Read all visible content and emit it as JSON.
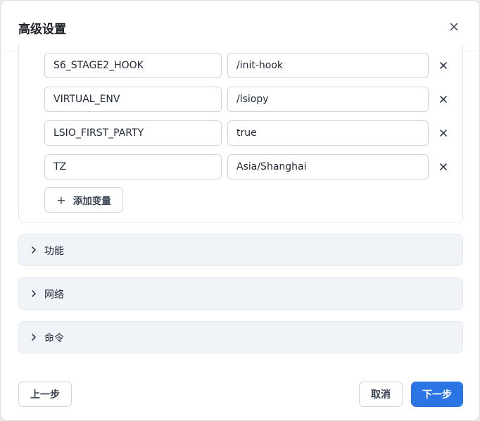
{
  "dialog": {
    "title": "高级设置",
    "close_icon": "close-icon"
  },
  "env": {
    "rows": [
      {
        "key": "S6_STAGE2_HOOK",
        "value": "/init-hook"
      },
      {
        "key": "VIRTUAL_ENV",
        "value": "/lsiopy"
      },
      {
        "key": "LSIO_FIRST_PARTY",
        "value": "true"
      },
      {
        "key": "TZ",
        "value": "Asia/Shanghai"
      }
    ],
    "add_label": "添加变量",
    "remove_glyph": "×",
    "add_glyph": "+"
  },
  "sections": [
    {
      "label": "功能"
    },
    {
      "label": "网络"
    },
    {
      "label": "命令"
    }
  ],
  "footer": {
    "prev_label": "上一步",
    "cancel_label": "取消",
    "next_label": "下一步"
  },
  "colors": {
    "primary": "#2b74e4",
    "section_bg": "#f0f3f7"
  }
}
